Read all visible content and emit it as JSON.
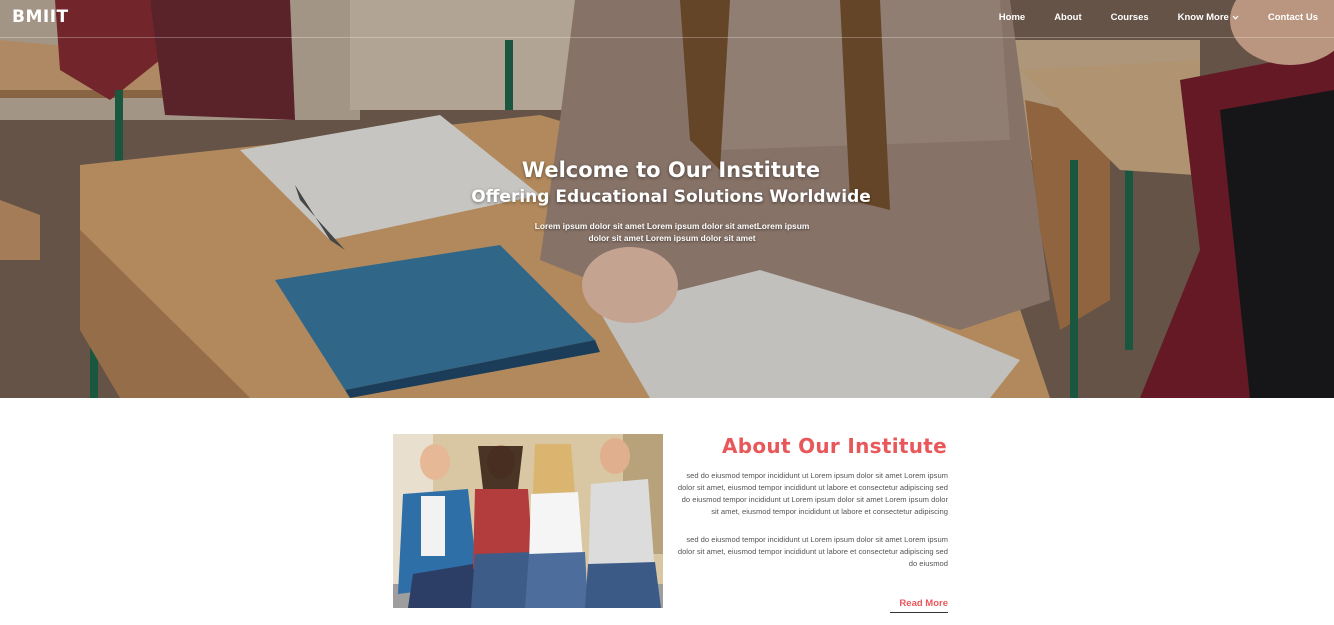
{
  "nav": {
    "brand": "BMIIT",
    "items": [
      {
        "label": "Home"
      },
      {
        "label": "About"
      },
      {
        "label": "Courses"
      },
      {
        "label": "Know More",
        "has_dropdown": true
      },
      {
        "label": "Contact Us"
      }
    ]
  },
  "hero": {
    "title": "Welcome to Our Institute",
    "subtitle": "Offering Educational Solutions Worldwide",
    "description": "Lorem ipsum dolor sit amet Lorem ipsum dolor sit ametLorem ipsum dolor sit amet Lorem ipsum dolor sit amet"
  },
  "about": {
    "title": "About Our Institute",
    "paragraph1": "sed do eiusmod tempor incididunt ut Lorem ipsum dolor sit amet Lorem ipsum dolor sit amet, eiusmod tempor incididunt ut labore et consectetur adipiscing sed do eiusmod tempor incididunt ut Lorem ipsum dolor sit amet Lorem ipsum dolor sit amet, eiusmod tempor incididunt ut labore et consectetur adipiscing",
    "paragraph2": "sed do eiusmod tempor incididunt ut Lorem ipsum dolor sit amet Lorem ipsum dolor sit amet, eiusmod tempor incididunt ut labore et consectetur adipiscing sed do eiusmod",
    "read_more": "Read More"
  },
  "colors": {
    "accent": "#e8585a",
    "nav_text": "#ffffff",
    "body_text": "#555555"
  }
}
